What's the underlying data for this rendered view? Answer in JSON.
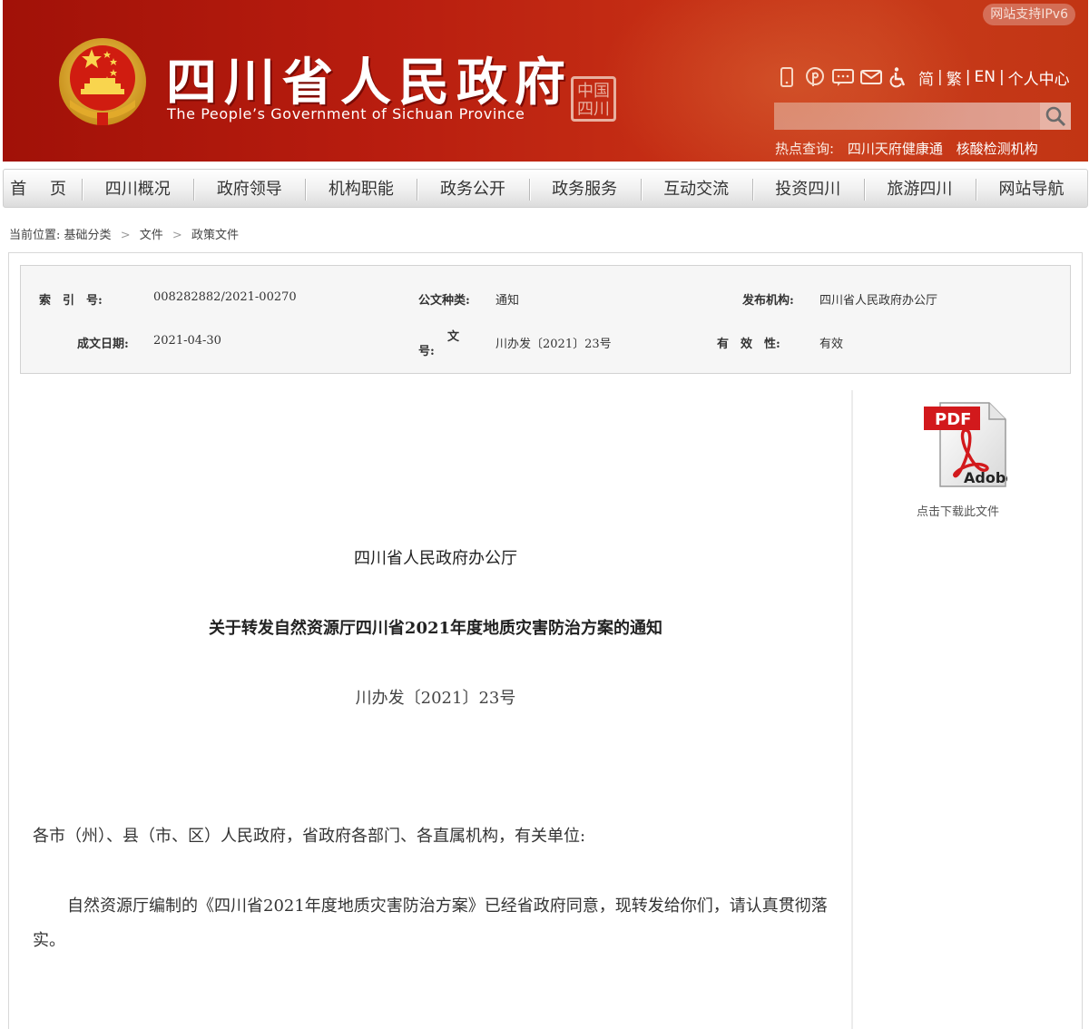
{
  "header": {
    "title": "四川省人民政府",
    "subtitle": "The People’s Government of Sichuan Province",
    "seal_text": "中国四川",
    "ipv6_badge": "网站支持IPv6",
    "tools": [
      "mobile-icon",
      "weibo-icon",
      "wechat-icon",
      "mail-icon",
      "accessibility-icon"
    ],
    "lang": {
      "simplified": "简",
      "traditional": "繁",
      "english": "EN",
      "personal": "个人中心",
      "sep": "|"
    },
    "search_placeholder": "",
    "hot_label": "热点查询:",
    "hot_links": [
      "四川天府健康通",
      "核酸检测机构"
    ]
  },
  "nav": {
    "items": [
      "首 页",
      "四川概况",
      "政府领导",
      "机构职能",
      "政务公开",
      "政务服务",
      "互动交流",
      "投资四川",
      "旅游四川",
      "网站导航"
    ]
  },
  "breadcrumb": {
    "label": "当前位置:",
    "items": [
      "基础分类",
      "文件",
      "政策文件"
    ],
    "sep": ">"
  },
  "meta": {
    "index_label": "索　引　号:",
    "index_value": "008282882/2021-00270",
    "type_label": "公文种类:",
    "type_value": "通知",
    "org_label": "发布机构:",
    "org_value": "四川省人民政府办公厅",
    "date_label": "成文日期:",
    "date_value": "2021-04-30",
    "docno_label_1": "文",
    "docno_label_2": "号:",
    "docno_value": "川办发〔2021〕23号",
    "valid_label": "有　效　性:",
    "valid_value": "有效"
  },
  "download": {
    "pdf_label": "PDF",
    "adobe_label": "Adobe",
    "caption": "点击下载此文件"
  },
  "article": {
    "issuer": "四川省人民政府办公厅",
    "title": "关于转发自然资源厅四川省2021年度地质灾害防治方案的通知",
    "doc_no": "川办发〔2021〕23号",
    "recipient": "各市（州）、县（市、区）人民政府，省政府各部门、各直属机构，有关单位:",
    "paragraph": "自然资源厅编制的《四川省2021年度地质灾害防治方案》已经省政府同意，现转发给你们，请认真贯彻落实。"
  },
  "colors": {
    "header_red": "#b81d0f",
    "accent_text": "#333333"
  }
}
